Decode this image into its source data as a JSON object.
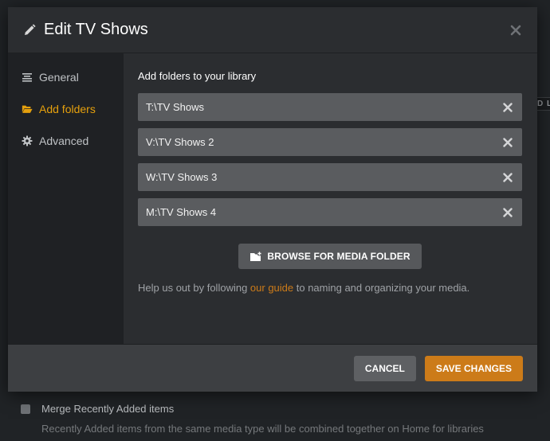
{
  "modal": {
    "title": "Edit TV Shows",
    "icons": {
      "edit": "pencil-icon",
      "close": "close-icon"
    }
  },
  "sidebar": {
    "items": [
      {
        "label": "General",
        "icon": "list-icon",
        "active": false
      },
      {
        "label": "Add folders",
        "icon": "folder-open-icon",
        "active": true
      },
      {
        "label": "Advanced",
        "icon": "gear-icon",
        "active": false
      }
    ]
  },
  "content": {
    "heading": "Add folders to your library",
    "folders": [
      {
        "value": "T:\\TV Shows"
      },
      {
        "value": "V:\\TV Shows 2"
      },
      {
        "value": "W:\\TV Shows 3"
      },
      {
        "value": "M:\\TV Shows 4"
      }
    ],
    "browse_label": "BROWSE FOR MEDIA FOLDER",
    "help": {
      "before": "Help us out by following ",
      "link": "our guide",
      "after": " to naming and organizing your media."
    }
  },
  "footer": {
    "cancel_label": "CANCEL",
    "save_label": "SAVE CHANGES"
  },
  "background": {
    "tag_text": "D L",
    "merge_label": "Merge Recently Added items",
    "merge_desc": "Recently Added items from the same media type will be combined together on Home for libraries"
  },
  "colors": {
    "accent": "#e5a00d",
    "save_button": "#cc7b19",
    "link": "#cc7b19"
  }
}
